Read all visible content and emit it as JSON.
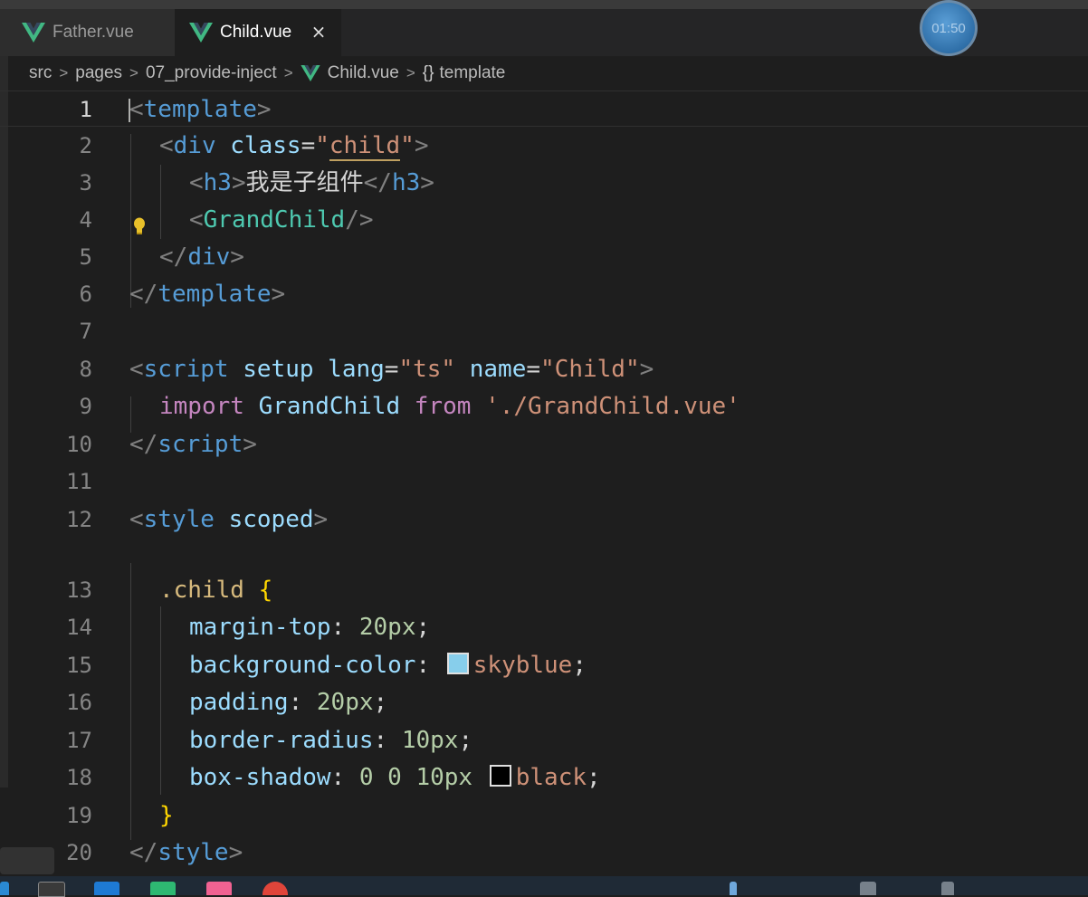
{
  "tabs": [
    {
      "label": "Father.vue",
      "active": false
    },
    {
      "label": "Child.vue",
      "active": true,
      "close": "×"
    }
  ],
  "timer": "01:50",
  "breadcrumb": {
    "parts": [
      "src",
      "pages",
      "07_provide-inject",
      "Child.vue",
      "template"
    ],
    "separator": ">",
    "symbol": "{}"
  },
  "lines": {
    "n1": "1",
    "n2": "2",
    "n3": "3",
    "n4": "4",
    "n5": "5",
    "n6": "6",
    "n7": "7",
    "n8": "8",
    "n9": "9",
    "n10": "10",
    "n11": "11",
    "n12": "12",
    "n13": "13",
    "n14": "14",
    "n15": "15",
    "n16": "16",
    "n17": "17",
    "n18": "18",
    "n19": "19",
    "n20": "20"
  },
  "code": {
    "l1_tag": "template",
    "l2_tag": "div",
    "l2_attr": "class",
    "l2_val": "child",
    "l3_tag": "h3",
    "l3_text": "我是子组件",
    "l4_comp": "GrandChild",
    "l5_tag": "div",
    "l6_tag": "template",
    "l8_tag": "script",
    "l8_a1": "setup",
    "l8_a2": "lang",
    "l8_v2": "ts",
    "l8_a3": "name",
    "l8_v3": "Child",
    "l9_kw1": "import",
    "l9_var": "GrandChild",
    "l9_kw2": "from",
    "l9_str": "'./GrandChild.vue'",
    "l10_tag": "script",
    "l12_tag": "style",
    "l12_attr": "scoped",
    "l13_sel": ".child",
    "l14_prop": "margin-top",
    "l14_val": "20px",
    "l15_prop": "background-color",
    "l15_val": "skyblue",
    "l16_prop": "padding",
    "l16_val": "20px",
    "l17_prop": "border-radius",
    "l17_val": "10px",
    "l18_prop": "box-shadow",
    "l18_val_num": "0 0 10px",
    "l18_val": "black",
    "l20_tag": "style"
  },
  "colors": {
    "skyblue_swatch": "#87ceeb",
    "black_swatch": "#000000",
    "vue_green": "#41b883",
    "editor_bg": "#1e1e1e"
  },
  "icons": [
    "vue-icon",
    "close-icon",
    "chevron-right-icon",
    "lightbulb-icon",
    "color-swatch-icon"
  ]
}
